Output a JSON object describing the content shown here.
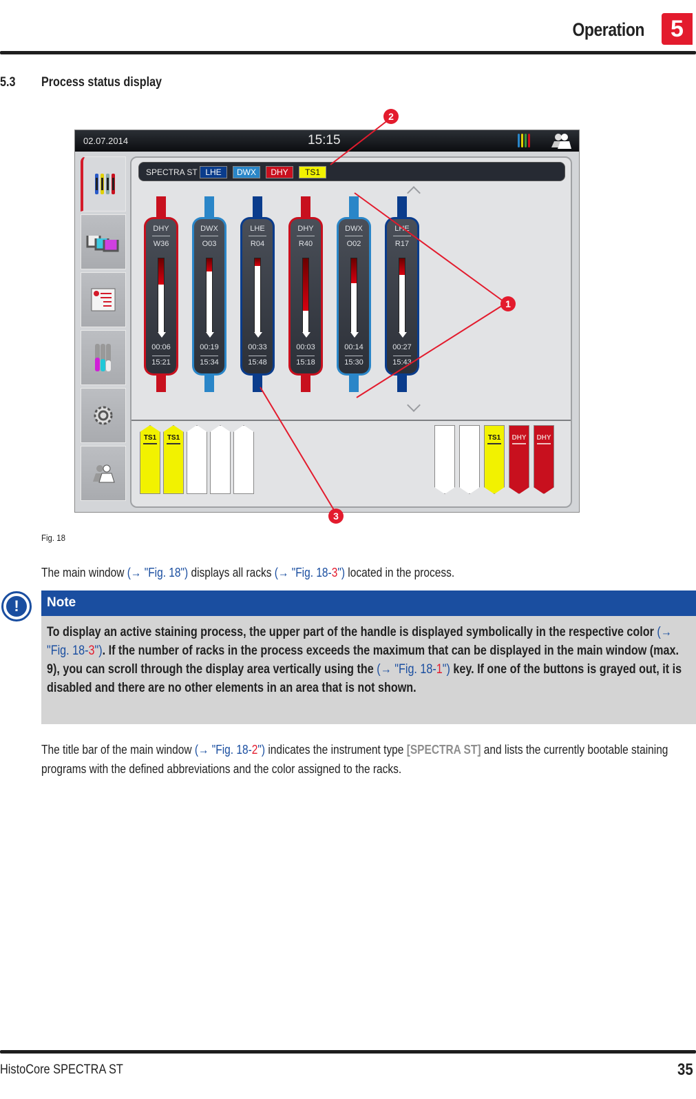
{
  "header": {
    "chapter_title": "Operation",
    "chapter_number": "5"
  },
  "section": {
    "number": "5.3",
    "title": "Process status display"
  },
  "figure": {
    "topbar": {
      "date": "02.07.2014",
      "time": "15:15"
    },
    "sidebar": [
      {
        "name": "racks",
        "active": true
      },
      {
        "name": "reagent-baths",
        "active": false
      },
      {
        "name": "programs",
        "active": false
      },
      {
        "name": "reagents",
        "active": false
      },
      {
        "name": "settings",
        "active": false
      },
      {
        "name": "user",
        "active": false
      }
    ],
    "titlebar": {
      "instrument": "SPECTRA ST",
      "programs": [
        {
          "label": "LHE",
          "color": "#0a3c8c",
          "text": "#ffffff"
        },
        {
          "label": "DWX",
          "color": "#2a86c8",
          "text": "#ffffff"
        },
        {
          "label": "DHY",
          "color": "#c8101e",
          "text": "#ffffff"
        },
        {
          "label": "TS1",
          "color": "#f2f200",
          "text": "#111111"
        }
      ]
    },
    "racks": [
      {
        "program": "DHY",
        "step": "W36",
        "remaining": "00:06",
        "end": "15:21",
        "color": "#c8101e",
        "progress": 0.35
      },
      {
        "program": "DWX",
        "step": "O03",
        "remaining": "00:19",
        "end": "15:34",
        "color": "#2a86c8",
        "progress": 0.18
      },
      {
        "program": "LHE",
        "step": "R04",
        "remaining": "00:33",
        "end": "15:48",
        "color": "#0a3c8c",
        "progress": 0.1
      },
      {
        "program": "DHY",
        "step": "R40",
        "remaining": "00:03",
        "end": "15:18",
        "color": "#c8101e",
        "progress": 0.7
      },
      {
        "program": "DWX",
        "step": "O02",
        "remaining": "00:14",
        "end": "15:30",
        "color": "#2a86c8",
        "progress": 0.33
      },
      {
        "program": "LHE",
        "step": "R17",
        "remaining": "00:27",
        "end": "15:43",
        "color": "#0a3c8c",
        "progress": 0.22
      }
    ],
    "drawer_left": [
      {
        "label": "TS1",
        "color": "#f2f200"
      },
      {
        "label": "TS1",
        "color": "#f2f200"
      },
      {
        "label": "",
        "color": "#ffffff"
      },
      {
        "label": "",
        "color": "#ffffff"
      },
      {
        "label": "",
        "color": "#ffffff"
      }
    ],
    "drawer_right": [
      {
        "label": "",
        "color": "#ffffff"
      },
      {
        "label": "",
        "color": "#ffffff"
      },
      {
        "label": "TS1",
        "color": "#f2f200"
      },
      {
        "label": "DHY",
        "color": "#c8101e"
      },
      {
        "label": "DHY",
        "color": "#c8101e"
      }
    ],
    "callouts": [
      "1",
      "2",
      "3"
    ],
    "caption": "Fig. 18"
  },
  "body": {
    "p1": {
      "t1": "The main window ",
      "l1": "(→ \"Fig. 18\")",
      "t2": " displays all racks ",
      "l2a": "(→ \"Fig. 18-",
      "l2n": "3",
      "l2b": "\")",
      "t3": " located in the process."
    },
    "note": {
      "heading": "Note",
      "t1": "To display an active staining process, the upper part of the handle is displayed symbolically in the respective color ",
      "l1a": "(→ \"Fig. 18-",
      "l1n": "3",
      "l1b": "\")",
      "t2": ". If the number of racks in the process exceeds the maximum that can be displayed in the main window (max. 9), you can scroll through the display area vertically using the ",
      "l2a": "(→ \"Fig. 18-",
      "l2n": "1",
      "l2b": "\")",
      "t3": " key. If one of the buttons is grayed out, it is disabled and there are no other elements in an area that is not shown."
    },
    "p2": {
      "t1": "The title bar of the main window ",
      "la": "(→ \"Fig. 18-",
      "ln": "2",
      "lb": "\")",
      "t2": " indicates the instrument type ",
      "g": "[SPECTRA ST]",
      "t3": " and lists the currently bootable staining programs with the defined abbreviations and the color assigned to the racks."
    }
  },
  "footer": {
    "product": "HistoCore SPECTRA ST",
    "page": "35"
  }
}
